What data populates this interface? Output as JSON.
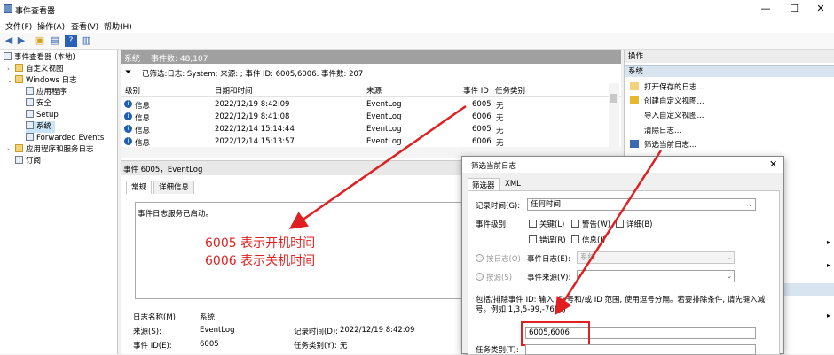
{
  "window": {
    "title": "事件查看器",
    "min": "—",
    "max": "☐",
    "close": "✕"
  },
  "menu": [
    "文件(F)",
    "操作(A)",
    "查看(V)",
    "帮助(H)"
  ],
  "toolbar": {
    "icons": [
      "back-arrow-icon",
      "forward-arrow-icon",
      "folder-up-icon",
      "properties-icon",
      "help-icon",
      "panel-icon"
    ]
  },
  "tree": {
    "root": "事件查看器 (本地)",
    "custom_views": "自定义视图",
    "windows_logs": "Windows 日志",
    "logs": [
      "应用程序",
      "安全",
      "Setup",
      "系统",
      "Forwarded Events"
    ],
    "app_services": "应用程序和服务日志",
    "subscriptions": "订阅"
  },
  "center": {
    "header_name": "系统",
    "header_count": "事件数: 48,107",
    "filter_text": "已筛选:日志: System; 来源: ; 事件 ID: 6005,6006. 事件数: 207",
    "columns": [
      "级别",
      "日期和时间",
      "来源",
      "事件 ID",
      "任务类别"
    ],
    "rows": [
      {
        "level": "信息",
        "datetime": "2022/12/19 8:42:09",
        "source": "EventLog",
        "id": "6005",
        "task": "无"
      },
      {
        "level": "信息",
        "datetime": "2022/12/19 8:41:08",
        "source": "EventLog",
        "id": "6006",
        "task": "无"
      },
      {
        "level": "信息",
        "datetime": "2022/12/14 15:14:44",
        "source": "EventLog",
        "id": "6005",
        "task": "无"
      },
      {
        "level": "信息",
        "datetime": "2022/12/14 15:13:57",
        "source": "EventLog",
        "id": "6006",
        "task": "无"
      }
    ],
    "detail_title": "事件 6005，EventLog",
    "tabs": [
      "常规",
      "详细信息"
    ],
    "message": "事件日志服务已启动。",
    "annotation_line1": "6005 表示开机时间",
    "annotation_line2": "6006 表示关机时间",
    "log_name_label": "日志名称(M):",
    "log_name": "系统",
    "source_label": "来源(S):",
    "source": "EventLog",
    "logged_label": "记录时间(D):",
    "logged": "2022/12/19 8:42:09",
    "event_id_label": "事件 ID(E):",
    "event_id": "6005",
    "task_label": "任务类别(Y):",
    "task": "无"
  },
  "actions": {
    "header": "操作",
    "section": "系统",
    "items": [
      "打开保存的日志...",
      "创建自定义视图...",
      "导入自定义视图...",
      "清除日志...",
      "筛选当前日志..."
    ]
  },
  "dialog": {
    "title": "筛选当前日志",
    "close": "✕",
    "tabs": [
      "筛选器",
      "XML"
    ],
    "logged_label": "记录时间(G):",
    "logged_value": "任何时间",
    "level_label": "事件级别:",
    "levels": [
      "关键(L)",
      "警告(W)",
      "详细(B)",
      "错误(R)",
      "信息(I)"
    ],
    "by_log": "按日志(O)",
    "by_source": "按源(S)",
    "event_logs_label": "事件日志(E):",
    "event_logs_value": "系统",
    "event_sources_label": "事件来源(V):",
    "event_sources_value": "",
    "hint": "包括/排除事件 ID: 输入 ID 号和/或 ID 范围, 使用逗号分隔。若要排除条件, 请先键入减号。例如 1,3,5-99,-76(N)",
    "ids_value": "6005,6006",
    "task_category_label": "任务类别(T):"
  },
  "colors": {
    "annotation": "#e02020",
    "selected": "#cce4f7",
    "header_bar": "#a0a0a0"
  }
}
